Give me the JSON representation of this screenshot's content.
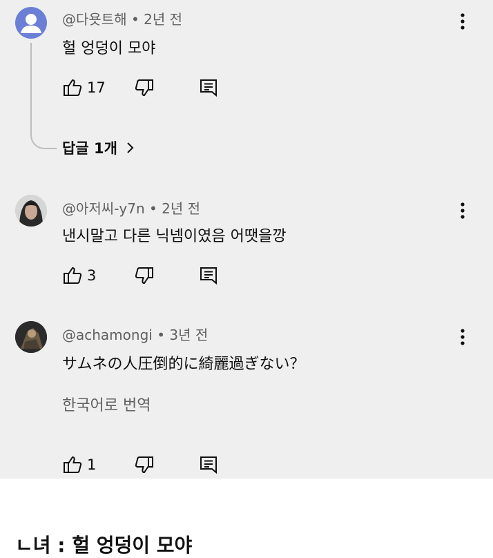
{
  "comments": [
    {
      "author": "@다욧트해",
      "time": "2년 전",
      "text": "헐 엉덩이 모야",
      "likes": "17",
      "avatar": "default-person-icon",
      "avatar_color": "#6b7fd7",
      "replies_label": "답글 1개"
    },
    {
      "author": "@아저씨-y7n",
      "time": "2년 전",
      "text": "낸시말고 다른 닉넴이였음 어땟을깡",
      "likes": "3",
      "avatar": "profile-photo"
    },
    {
      "author": "@achamongi",
      "time": "3년 전",
      "text": "サムネの人圧倒的に綺麗過ぎない？",
      "translate_label": "한국어로 번역",
      "likes": "1",
      "avatar": "profile-photo"
    }
  ],
  "separator": "•",
  "caption": "ㄴ녀 : 헐 엉덩이 모야",
  "colors": {
    "panel_bg": "#efefef",
    "meta_text": "#606060",
    "text": "#0f0f0f"
  }
}
